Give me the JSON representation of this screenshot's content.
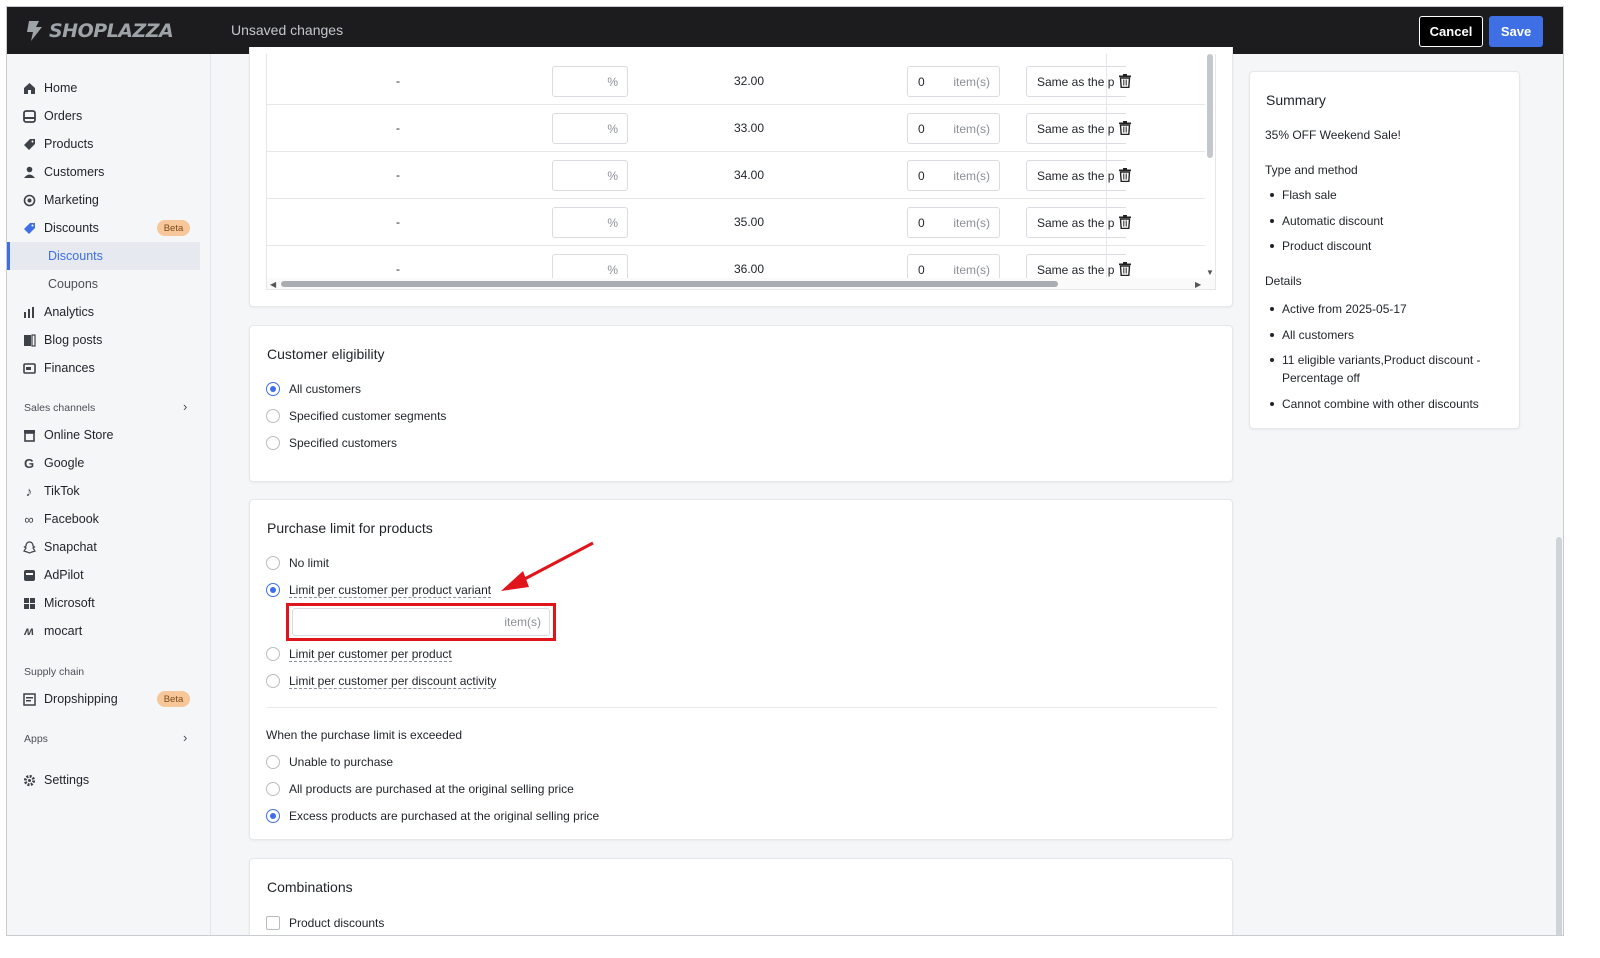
{
  "topbar": {
    "logo_text": "SHOPLAZZA",
    "status": "Unsaved changes",
    "cancel_label": "Cancel",
    "save_label": "Save",
    "accent": "#3f6fe4"
  },
  "sidebar": {
    "items": [
      {
        "label": "Home",
        "icon": "home-icon"
      },
      {
        "label": "Orders",
        "icon": "orders-icon"
      },
      {
        "label": "Products",
        "icon": "tag-icon"
      },
      {
        "label": "Customers",
        "icon": "person-icon"
      },
      {
        "label": "Marketing",
        "icon": "marketing-icon"
      },
      {
        "label": "Discounts",
        "icon": "discount-icon",
        "badge": "Beta"
      }
    ],
    "discount_sub": [
      {
        "label": "Discounts",
        "active": true
      },
      {
        "label": "Coupons",
        "active": false
      }
    ],
    "items2": [
      {
        "label": "Analytics",
        "icon": "analytics-icon"
      },
      {
        "label": "Blog posts",
        "icon": "blog-icon"
      },
      {
        "label": "Finances",
        "icon": "finances-icon"
      }
    ],
    "sales_channels_label": "Sales channels",
    "channels": [
      {
        "label": "Online Store",
        "icon": "store-icon"
      },
      {
        "label": "Google",
        "icon": "google-icon"
      },
      {
        "label": "TikTok",
        "icon": "tiktok-icon"
      },
      {
        "label": "Facebook",
        "icon": "meta-icon"
      },
      {
        "label": "Snapchat",
        "icon": "snapchat-icon"
      },
      {
        "label": "AdPilot",
        "icon": "adpilot-icon"
      },
      {
        "label": "Microsoft",
        "icon": "microsoft-icon"
      },
      {
        "label": "mocart",
        "icon": "mocart-icon"
      }
    ],
    "supply_chain_label": "Supply chain",
    "dropshipping": {
      "label": "Dropshipping",
      "badge": "Beta"
    },
    "apps_label": "Apps",
    "settings_label": "Settings"
  },
  "variant_table": {
    "rows": [
      {
        "dash": "-",
        "pct_unit": "%",
        "price": "32.00",
        "qty": "0",
        "qty_unit": "item(s)",
        "inventory": "Same as the p"
      },
      {
        "dash": "-",
        "pct_unit": "%",
        "price": "33.00",
        "qty": "0",
        "qty_unit": "item(s)",
        "inventory": "Same as the p"
      },
      {
        "dash": "-",
        "pct_unit": "%",
        "price": "34.00",
        "qty": "0",
        "qty_unit": "item(s)",
        "inventory": "Same as the p"
      },
      {
        "dash": "-",
        "pct_unit": "%",
        "price": "35.00",
        "qty": "0",
        "qty_unit": "item(s)",
        "inventory": "Same as the p"
      },
      {
        "dash": "-",
        "pct_unit": "%",
        "price": "36.00",
        "qty": "0",
        "qty_unit": "item(s)",
        "inventory": "Same as the p"
      }
    ]
  },
  "customer_eligibility": {
    "title": "Customer eligibility",
    "options": [
      {
        "label": "All customers",
        "selected": true
      },
      {
        "label": "Specified customer segments",
        "selected": false
      },
      {
        "label": "Specified customers",
        "selected": false
      }
    ]
  },
  "purchase_limit": {
    "title": "Purchase limit for products",
    "options": [
      {
        "label": "No limit",
        "selected": false
      },
      {
        "label": "Limit per customer per product variant",
        "selected": true
      },
      {
        "label": "Limit per customer per product",
        "selected": false
      },
      {
        "label": "Limit per customer per discount activity",
        "selected": false
      }
    ],
    "limit_input_value": "",
    "limit_input_unit": "item(s)",
    "exceeded_label": "When the purchase limit is exceeded",
    "exceeded_options": [
      {
        "label": "Unable to purchase",
        "selected": false
      },
      {
        "label": "All products are purchased at the original selling price",
        "selected": false
      },
      {
        "label": "Excess products are purchased at the original selling price",
        "selected": true
      }
    ]
  },
  "combinations": {
    "title": "Combinations",
    "options": [
      {
        "label": "Product discounts",
        "checked": false
      }
    ]
  },
  "summary": {
    "title": "Summary",
    "name": "35% OFF Weekend Sale!",
    "type_heading": "Type and method",
    "type_items": [
      "Flash sale",
      "Automatic discount",
      "Product discount"
    ],
    "details_heading": "Details",
    "details_items": [
      "Active from 2025-05-17",
      "All customers",
      "11 eligible variants,Product discount - Percentage off",
      "Cannot combine with other discounts"
    ]
  },
  "annotation": {
    "highlight_color": "#e0151c"
  }
}
